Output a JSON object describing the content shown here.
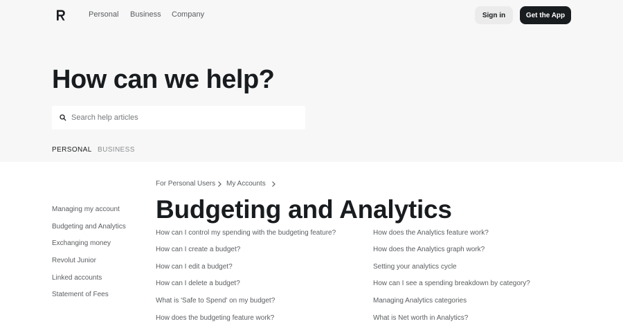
{
  "header": {
    "nav": [
      "Personal",
      "Business",
      "Company"
    ],
    "sign_in": "Sign in",
    "get_app": "Get the App"
  },
  "hero": {
    "title": "How can we help?",
    "search_placeholder": "Search help articles",
    "tabs": [
      "PERSONAL",
      "BUSINESS"
    ]
  },
  "breadcrumb": [
    "For Personal Users",
    "My Accounts"
  ],
  "sidebar": {
    "items": [
      "Managing my account",
      "Budgeting and Analytics",
      "Exchanging money",
      "Revolut Junior",
      "Linked accounts",
      "Statement of Fees"
    ]
  },
  "main": {
    "title": "Budgeting and Analytics",
    "articles_left": [
      "How can I control my spending with the budgeting feature?",
      "How can I create a budget?",
      "How can I edit a budget?",
      "How can I delete a budget?",
      "What is 'Safe to Spend' on my budget?",
      "How does the budgeting feature work?"
    ],
    "articles_right": [
      "How does the Analytics feature work?",
      "How does the Analytics graph work?",
      "Setting your analytics cycle",
      "How can I see a spending breakdown by category?",
      "Managing Analytics categories",
      "What is Net worth in Analytics?"
    ]
  },
  "colors": {
    "hero_bg": "#f7f7f7",
    "primary_button": "#191c1f",
    "link_text": "#5a5d60"
  }
}
